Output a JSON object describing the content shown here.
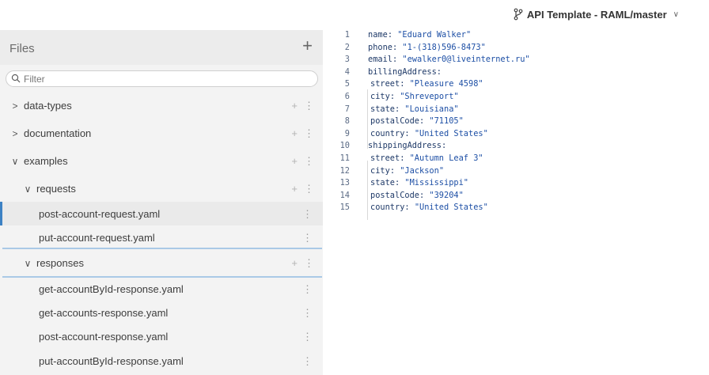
{
  "header": {
    "project": "API Template - RAML/master",
    "branch_icon": "branch-icon",
    "chevron": "∨"
  },
  "sidebar": {
    "title": "Files",
    "add": "+",
    "filter_placeholder": "Filter",
    "folders": [
      {
        "caret": ">",
        "label": "data-types"
      },
      {
        "caret": ">",
        "label": "documentation"
      },
      {
        "caret": "∨",
        "label": "examples"
      },
      {
        "caret": "∨",
        "label": "requests"
      },
      {
        "caret": "∨",
        "label": "responses"
      }
    ],
    "request_files": [
      "post-account-request.yaml",
      "put-account-request.yaml"
    ],
    "response_files": [
      "get-accountById-response.yaml",
      "get-accounts-response.yaml",
      "post-account-response.yaml",
      "put-accountById-response.yaml"
    ],
    "action_add": "+",
    "action_more": "⋮"
  },
  "editor": {
    "lines": [
      {
        "n": "1",
        "key": "name",
        "val": "\"Eduard Walker\""
      },
      {
        "n": "2",
        "key": "phone",
        "val": "\"1-(318)596-8473\""
      },
      {
        "n": "3",
        "key": "email",
        "val": "\"ewalker0@liveinternet.ru\""
      },
      {
        "n": "4",
        "key": "billingAddress",
        "val": ""
      },
      {
        "n": "5",
        "key": "street",
        "val": "\"Pleasure 4598\""
      },
      {
        "n": "6",
        "key": "city",
        "val": "\"Shreveport\""
      },
      {
        "n": "7",
        "key": "state",
        "val": "\"Louisiana\""
      },
      {
        "n": "8",
        "key": "postalCode",
        "val": "\"71105\""
      },
      {
        "n": "9",
        "key": "country",
        "val": "\"United States\""
      },
      {
        "n": "10",
        "key": "shippingAddress",
        "val": ""
      },
      {
        "n": "11",
        "key": "street",
        "val": "\"Autumn Leaf 3\""
      },
      {
        "n": "12",
        "key": "city",
        "val": "\"Jackson\""
      },
      {
        "n": "13",
        "key": "state",
        "val": "\"Mississippi\""
      },
      {
        "n": "14",
        "key": "postalCode",
        "val": "\"39204\""
      },
      {
        "n": "15",
        "key": "country",
        "val": "\"United States\""
      }
    ]
  }
}
